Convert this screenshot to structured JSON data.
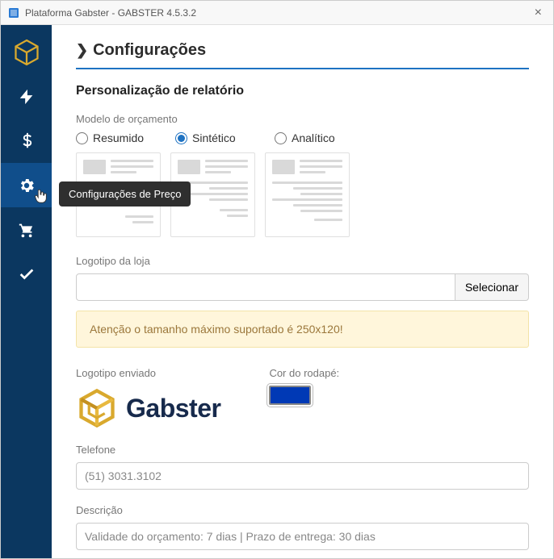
{
  "window": {
    "title": "Plataforma Gabster - GABSTER 4.5.3.2"
  },
  "tooltip": "Configurações de Preço",
  "page": {
    "title": "Configurações",
    "section": "Personalização de relatório"
  },
  "model": {
    "label": "Modelo de orçamento",
    "options": [
      "Resumido",
      "Sintético",
      "Analítico"
    ],
    "selected": "Sintético"
  },
  "logo_upload": {
    "label": "Logotipo da loja",
    "button": "Selecionar",
    "warning": "Atenção o tamanho máximo suportado é 250x120!"
  },
  "logo_sent": {
    "label": "Logotipo enviado",
    "brand": "Gabster"
  },
  "footer_color": {
    "label": "Cor do rodapé:",
    "value": "#0039b5"
  },
  "telefone": {
    "label": "Telefone",
    "value": "(51) 3031.3102"
  },
  "descricao": {
    "label": "Descrição",
    "value": "Validade do orçamento: 7 dias | Prazo de entrega: 30 dias"
  }
}
